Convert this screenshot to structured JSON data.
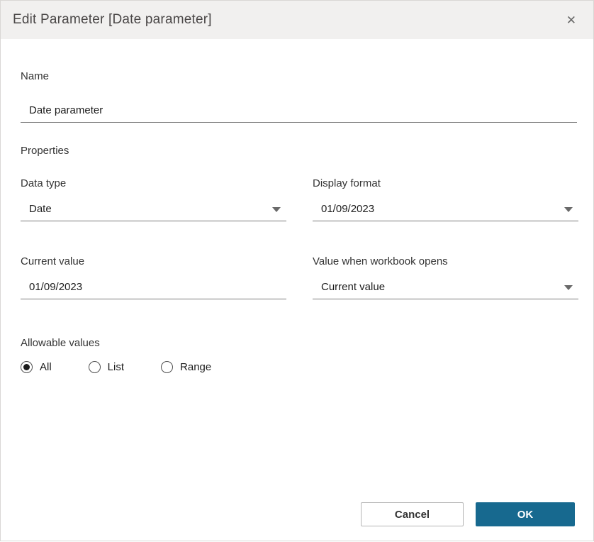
{
  "dialog": {
    "title": "Edit Parameter [Date parameter]",
    "close_icon": "✕"
  },
  "fields": {
    "name": {
      "label": "Name",
      "value": "Date parameter"
    },
    "properties_heading": "Properties",
    "data_type": {
      "label": "Data type",
      "value": "Date"
    },
    "display_format": {
      "label": "Display format",
      "value": "01/09/2023"
    },
    "current_value": {
      "label": "Current value",
      "value": "01/09/2023"
    },
    "value_when_workbook_opens": {
      "label": "Value when workbook opens",
      "value": "Current value"
    },
    "allowable_values": {
      "label": "Allowable values",
      "options": [
        {
          "label": "All",
          "selected": true
        },
        {
          "label": "List",
          "selected": false
        },
        {
          "label": "Range",
          "selected": false
        }
      ]
    }
  },
  "footer": {
    "cancel_label": "Cancel",
    "ok_label": "OK"
  },
  "colors": {
    "accent": "#17698f",
    "titlebar_bg": "#f1f0ef",
    "underline": "#7a7a7a",
    "text": "#333333"
  }
}
